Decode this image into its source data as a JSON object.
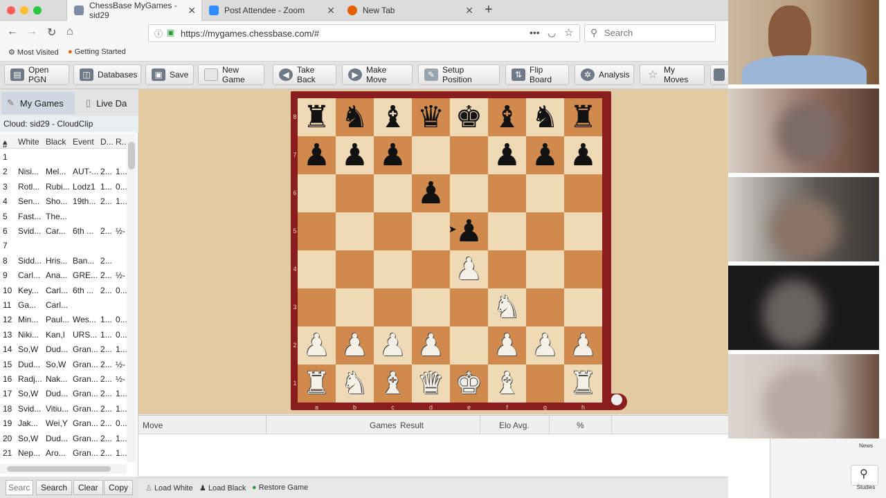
{
  "browser": {
    "tabs": [
      {
        "title": "ChessBase MyGames - sid29",
        "active": true
      },
      {
        "title": "Post Attendee - Zoom",
        "active": false
      },
      {
        "title": "New Tab",
        "active": false
      }
    ],
    "url": "https://mygames.chessbase.com/#",
    "search_placeholder": "Search",
    "bookmarks": [
      "Most Visited",
      "Getting Started"
    ]
  },
  "toolbar": {
    "buttons": [
      "Open PGN",
      "Databases",
      "Save",
      "New Game",
      "Take Back",
      "Make Move",
      "Setup Position",
      "Flip Board",
      "Analysis",
      "My Moves"
    ]
  },
  "sidebar": {
    "tabs": [
      "My Games",
      "Live Da"
    ],
    "cloud_title": "Cloud: sid29 - CloudClip",
    "columns": [
      "#",
      "White",
      "Black",
      "Event",
      "D...",
      "R..."
    ],
    "rows": [
      [
        "1",
        "",
        "",
        "",
        "",
        ""
      ],
      [
        "2",
        "Nisi...",
        "Mel...",
        "AUT-...",
        "2...",
        "1..."
      ],
      [
        "3",
        "Rotl...",
        "Rubi...",
        "Lodz1",
        "1...",
        "0..."
      ],
      [
        "4",
        "Sen...",
        "Sho...",
        "19th...",
        "2...",
        "1..."
      ],
      [
        "5",
        "Fast...",
        "The...",
        "",
        "",
        ""
      ],
      [
        "6",
        "Svid...",
        "Car...",
        "6th ...",
        "2...",
        "½-"
      ],
      [
        "7",
        "",
        "",
        "",
        "",
        ""
      ],
      [
        "8",
        "Sidd...",
        "Hris...",
        "Ban...",
        "2...",
        ""
      ],
      [
        "9",
        "Carl...",
        "Ana...",
        "GRE...",
        "2...",
        "½-"
      ],
      [
        "10",
        "Key...",
        "Carl...",
        "6th ...",
        "2...",
        "0..."
      ],
      [
        "11",
        "Ga...",
        "Carl...",
        "",
        "",
        ""
      ],
      [
        "12",
        "Min...",
        "Paul...",
        "Wes...",
        "1...",
        "0..."
      ],
      [
        "13",
        "Niki...",
        "Kan,I",
        "URS...",
        "1...",
        "0..."
      ],
      [
        "14",
        "So,W",
        "Dud...",
        "Gran...",
        "2...",
        "1..."
      ],
      [
        "15",
        "Dud...",
        "So,W",
        "Gran...",
        "2...",
        "½-"
      ],
      [
        "16",
        "Radj...",
        "Nak...",
        "Gran...",
        "2...",
        "½-"
      ],
      [
        "17",
        "So,W",
        "Dud...",
        "Gran...",
        "2...",
        "1..."
      ],
      [
        "18",
        "Svid...",
        "Vitiu...",
        "Gran...",
        "2...",
        "1..."
      ],
      [
        "19",
        "Jak...",
        "Wei,Y",
        "Gran...",
        "2...",
        "0..."
      ],
      [
        "20",
        "So,W",
        "Dud...",
        "Gran...",
        "2...",
        "1..."
      ],
      [
        "21",
        "Nep...",
        "Aro...",
        "Gran...",
        "2...",
        "1..."
      ]
    ],
    "search_placeholder": "Searc",
    "buttons": [
      "Search",
      "Clear",
      "Copy"
    ]
  },
  "board": {
    "files": [
      "a",
      "b",
      "c",
      "d",
      "e",
      "f",
      "g",
      "h"
    ],
    "ranks": [
      "8",
      "7",
      "6",
      "5",
      "4",
      "3",
      "2",
      "1"
    ],
    "position": [
      [
        "r",
        "n",
        "b",
        "q",
        "k",
        "b",
        "n",
        "r"
      ],
      [
        "p",
        "p",
        "p",
        "",
        "",
        "p",
        "p",
        "p"
      ],
      [
        "",
        "",
        "",
        "p",
        "",
        "",
        "",
        ""
      ],
      [
        "",
        "",
        "",
        "",
        "p",
        "",
        "",
        ""
      ],
      [
        "",
        "",
        "",
        "",
        "P",
        "",
        "",
        ""
      ],
      [
        "",
        "",
        "",
        "",
        "",
        "N",
        "",
        ""
      ],
      [
        "P",
        "P",
        "P",
        "P",
        "",
        "P",
        "P",
        "P"
      ],
      [
        "R",
        "N",
        "B",
        "Q",
        "K",
        "B",
        "",
        "R"
      ]
    ]
  },
  "moves_panel": {
    "columns": [
      "Move",
      "Games",
      "Result",
      "Elo Avg.",
      "%"
    ]
  },
  "bottom_bar": [
    "Load White",
    "Load Black",
    "Restore Game"
  ],
  "right_panel": [
    "News",
    "Studies"
  ]
}
